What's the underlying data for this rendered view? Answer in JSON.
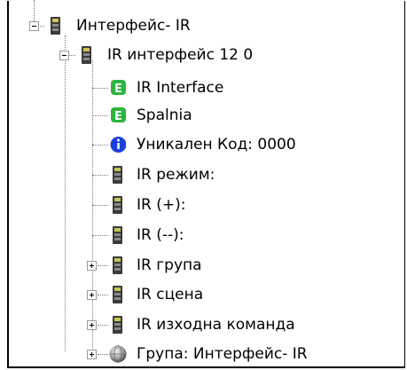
{
  "tree": {
    "root": {
      "label": "Интерфейс- IR",
      "icon": "device-module-icon",
      "expanded": true
    },
    "interface": {
      "label": "IR интерфейс 12 0",
      "icon": "device-module-icon",
      "expanded": true
    },
    "items": [
      {
        "label": "IR Interface",
        "icon": "green-e-icon"
      },
      {
        "label": "Spalnia",
        "icon": "green-e-icon"
      },
      {
        "label": "Уникален Код: 0000",
        "icon": "info-icon"
      },
      {
        "label": "IR режим:",
        "icon": "device-module-icon"
      },
      {
        "label": "IR (+):",
        "icon": "device-module-icon"
      },
      {
        "label": "IR (--):",
        "icon": "device-module-icon"
      },
      {
        "label": "IR група",
        "icon": "device-module-icon",
        "expandable": true
      },
      {
        "label": "IR сцена",
        "icon": "device-module-icon",
        "expandable": true
      },
      {
        "label": "IR изходна команда",
        "icon": "device-module-icon",
        "expandable": true
      },
      {
        "label": "Група: Интерфейс- IR",
        "icon": "group-sphere-icon",
        "expandable": true
      }
    ]
  },
  "colors": {
    "green_icon": "#2db53d",
    "info_icon": "#1a3fe0",
    "module_dark": "#3a3a3a"
  }
}
